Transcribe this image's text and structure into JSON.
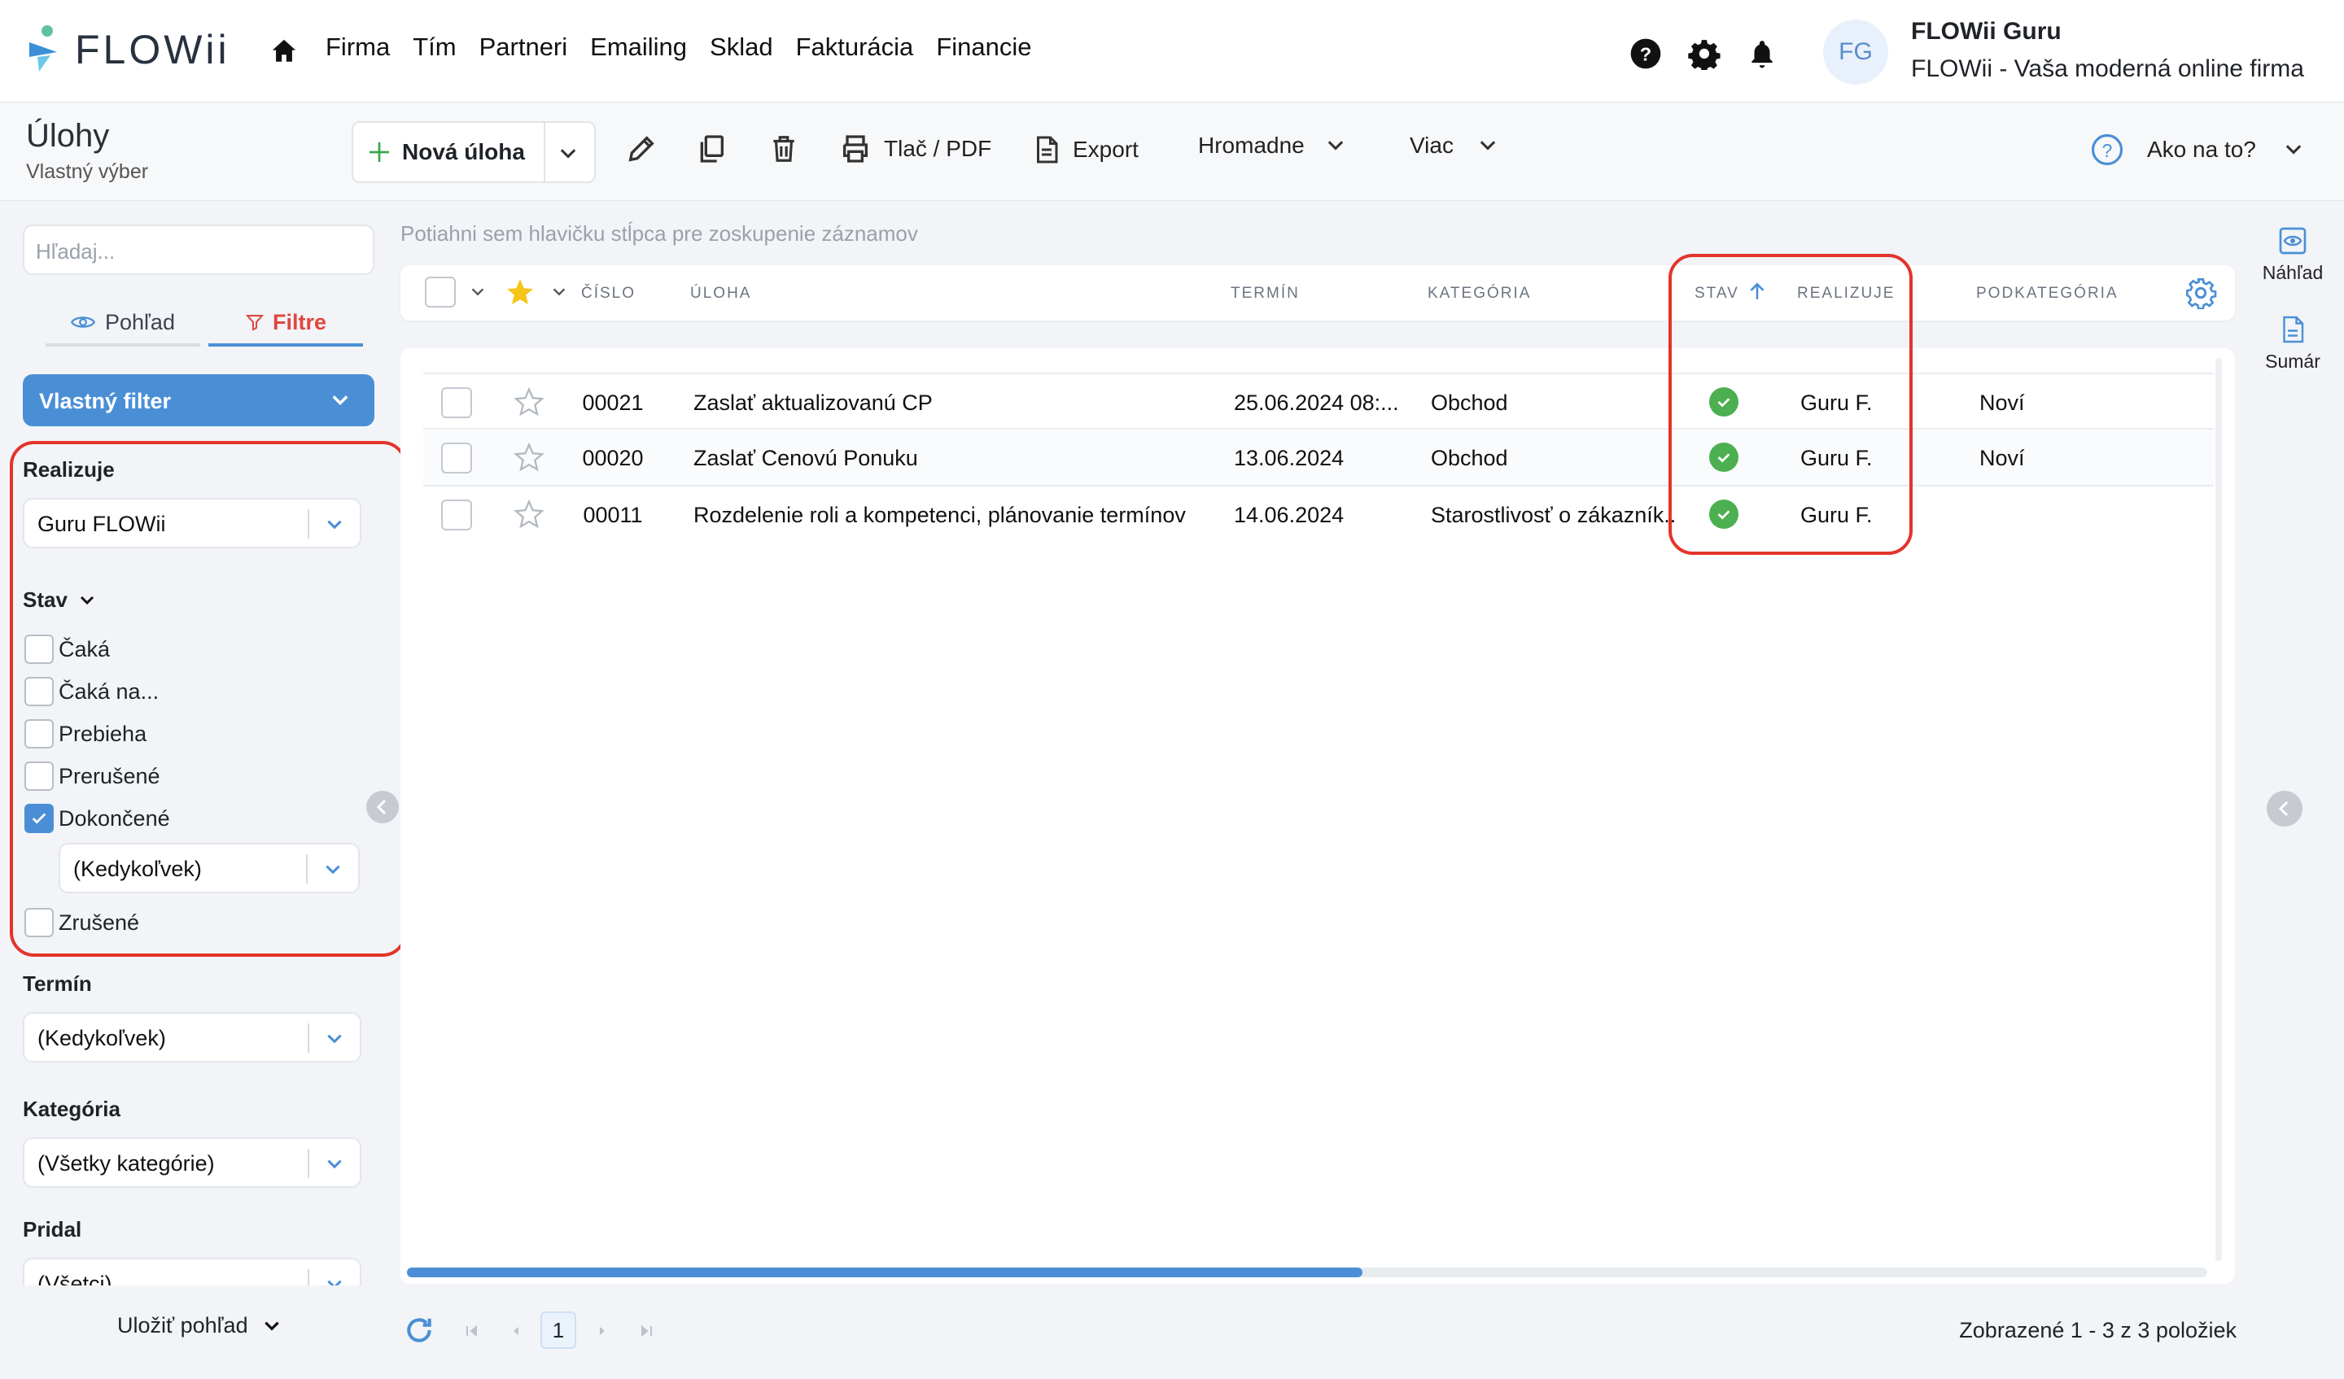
{
  "app": {
    "logo_text": "FLOWii"
  },
  "nav": {
    "items": [
      "Firma",
      "Tím",
      "Partneri",
      "Emailing",
      "Sklad",
      "Fakturácia",
      "Financie"
    ]
  },
  "user": {
    "initials": "FG",
    "name": "FLOWii Guru",
    "company": "FLOWii - Vaša moderná online firma"
  },
  "page": {
    "title": "Úlohy",
    "subtitle": "Vlastný výber"
  },
  "toolbar": {
    "new_task": "Nová úloha",
    "print": "Tlač / PDF",
    "export": "Export",
    "bulk": "Hromadne",
    "more": "Viac",
    "help": "Ako na to?"
  },
  "sidebar": {
    "search_placeholder": "Hľadaj...",
    "tab_view": "Pohľad",
    "tab_filters": "Filtre",
    "custom_filter": "Vlastný filter",
    "assignee_label": "Realizuje",
    "assignee_value": "Guru FLOWii",
    "status_label": "Stav",
    "statuses": [
      {
        "label": "Čaká",
        "checked": false
      },
      {
        "label": "Čaká na...",
        "checked": false
      },
      {
        "label": "Prebieha",
        "checked": false
      },
      {
        "label": "Prerušené",
        "checked": false
      },
      {
        "label": "Dokončené",
        "checked": true
      },
      {
        "label": "Zrušené",
        "checked": false
      }
    ],
    "completed_when": "(Kedykoľvek)",
    "term_label": "Termín",
    "term_value": "(Kedykoľvek)",
    "category_label": "Kategória",
    "category_value": "(Všetky kategórie)",
    "added_label": "Pridal",
    "added_value": "(Všetci)",
    "save_view": "Uložiť pohľad"
  },
  "grid": {
    "group_hint": "Potiahni sem hlavičku stĺpca pre zoskupenie záznamov",
    "columns": {
      "number": "ČÍSLO",
      "task": "ÚLOHA",
      "term": "TERMÍN",
      "category": "KATEGÓRIA",
      "status": "STAV",
      "assignee": "REALIZUJE",
      "subcategory": "PODKATEGÓRIA"
    },
    "rows": [
      {
        "number": "00021",
        "task": "Zaslať aktualizovanú CP",
        "term": "25.06.2024 08:...",
        "category": "Obchod",
        "status": "done",
        "assignee": "Guru F.",
        "subcategory": "Noví"
      },
      {
        "number": "00020",
        "task": "Zaslať Cenovú Ponuku",
        "term": "13.06.2024",
        "category": "Obchod",
        "status": "done",
        "assignee": "Guru F.",
        "subcategory": "Noví"
      },
      {
        "number": "00011",
        "task": "Rozdelenie roli a kompetenci, plánovanie termínov",
        "term": "14.06.2024",
        "category": "Starostlivosť o zákazník...",
        "status": "done",
        "assignee": "Guru F.",
        "subcategory": ""
      }
    ]
  },
  "pager": {
    "current_page": "1",
    "summary": "Zobrazené 1 - 3 z 3 položiek"
  },
  "right_rail": {
    "preview": "Náhľad",
    "summary": "Sumár"
  },
  "colors": {
    "accent": "#4a8fd6",
    "highlight": "#e3342b",
    "success": "#4caf50",
    "filter_tab": "#e0463f"
  }
}
